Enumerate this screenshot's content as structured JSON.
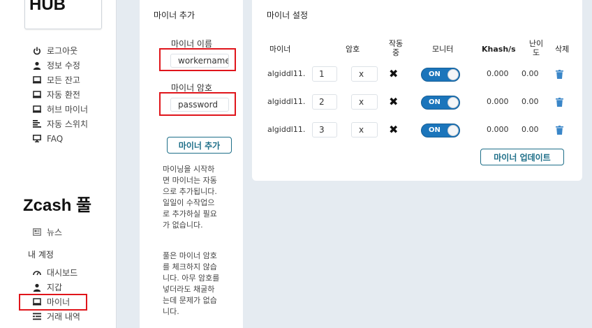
{
  "sidebar": {
    "logo": "HUB",
    "hub_menu": [
      {
        "icon": "power-icon",
        "label": "로그아웃"
      },
      {
        "icon": "user-icon",
        "label": "정보 수정"
      },
      {
        "icon": "monitor-icon",
        "label": "모든 잔고"
      },
      {
        "icon": "monitor-icon",
        "label": "자동 환전"
      },
      {
        "icon": "monitor-icon",
        "label": "허브 마이너"
      },
      {
        "icon": "list-icon",
        "label": "자동 스위치"
      },
      {
        "icon": "desktop-icon",
        "label": "FAQ"
      }
    ],
    "pool_title": "Zcash 풀",
    "news": {
      "icon": "newspaper-icon",
      "label": "뉴스"
    },
    "account_section": "내 계정",
    "account_menu": [
      {
        "icon": "dashboard-icon",
        "label": "대시보드"
      },
      {
        "icon": "user-icon",
        "label": "지갑"
      },
      {
        "icon": "monitor-icon",
        "label": "마이너"
      },
      {
        "icon": "transactions-icon",
        "label": "거래 내역"
      }
    ]
  },
  "add_miner": {
    "title": "마이너 추가",
    "name_label": "마이너 이름",
    "name_value": "workername",
    "password_label": "마이너 암호",
    "password_value": "password",
    "add_button": "마이너 추가",
    "help1": "마이닝을 시작하면 마이너는 자동으로 추가됩니다. 일일이 수작업으로 추가하실 필요가 없습니다.",
    "help2": "풀은 마이너 암호를 체크하지 않습니다. 아무 암호를 넣더라도 채굴하는데 문제가 없습니다."
  },
  "miner_settings": {
    "title": "마이너 설정",
    "columns": {
      "miner": "마이너",
      "password": "암호",
      "active": "작동중",
      "monitor": "모니터",
      "hashrate": "Khash/s",
      "difficulty": "난이도",
      "delete": "삭제"
    },
    "rows": [
      {
        "name": "algiddl11.",
        "worker": "1",
        "password": "x",
        "active": "✖",
        "monitor": "ON",
        "hashrate": "0.000",
        "difficulty": "0.00"
      },
      {
        "name": "algiddl11.",
        "worker": "2",
        "password": "x",
        "active": "✖",
        "monitor": "ON",
        "hashrate": "0.000",
        "difficulty": "0.00"
      },
      {
        "name": "algiddl11.",
        "worker": "3",
        "password": "x",
        "active": "✖",
        "monitor": "ON",
        "hashrate": "0.000",
        "difficulty": "0.00"
      }
    ],
    "update_button": "마이너 업데이트"
  },
  "colors": {
    "toggle_on": "#1b75bb",
    "highlight": "#e0151b",
    "button_text": "#1d6e88",
    "trash": "#3a86c8"
  }
}
